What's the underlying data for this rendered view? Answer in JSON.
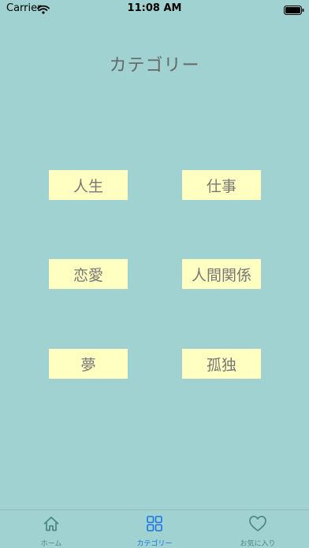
{
  "status_bar": {
    "carrier": "Carrier",
    "time": "11:08 AM"
  },
  "page": {
    "title": "カテゴリー"
  },
  "categories": [
    {
      "label": "人生"
    },
    {
      "label": "仕事"
    },
    {
      "label": "恋愛"
    },
    {
      "label": "人間関係"
    },
    {
      "label": "夢"
    },
    {
      "label": "孤独"
    }
  ],
  "tabs": [
    {
      "label": "ホーム",
      "icon": "home-icon"
    },
    {
      "label": "カテゴリー",
      "icon": "grid-icon"
    },
    {
      "label": "お気に入り",
      "icon": "heart-icon"
    }
  ],
  "colors": {
    "background": "#a0d2d1",
    "button": "#ffffc2",
    "active_tab": "#1a73e8",
    "inactive_tab": "#4a8a86"
  }
}
